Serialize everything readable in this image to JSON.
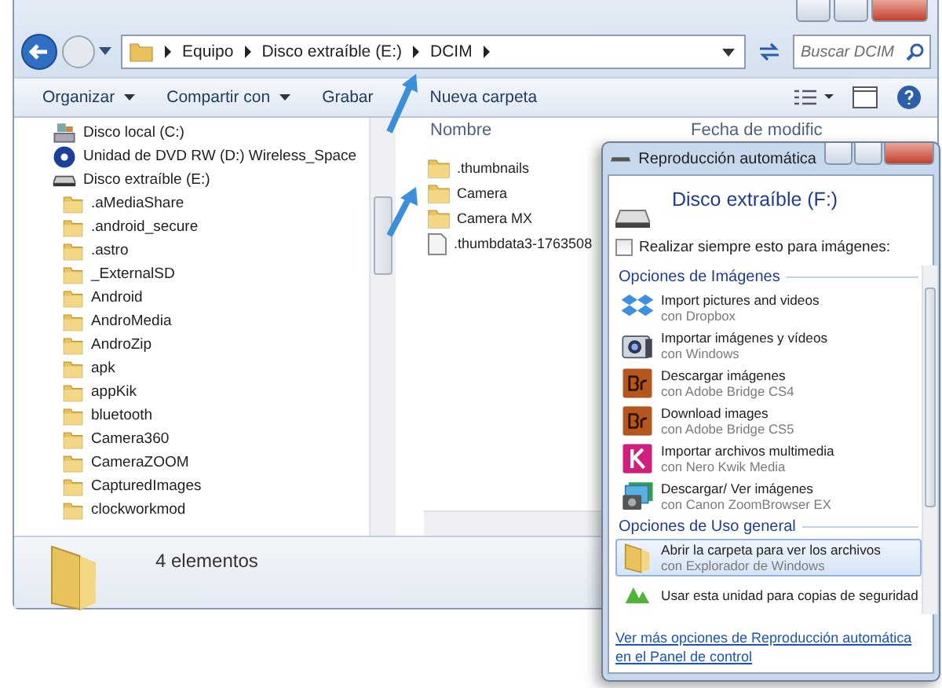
{
  "explorer": {
    "breadcrumb": [
      "Equipo",
      "Disco extraíble (E:)",
      "DCIM"
    ],
    "search": {
      "placeholder": "Buscar DCIM"
    },
    "toolbar": [
      {
        "label": "Organizar",
        "menu": true
      },
      {
        "label": "Compartir con",
        "menu": true
      },
      {
        "label": "Grabar",
        "menu": false
      },
      {
        "label": "Nueva carpeta",
        "menu": false
      }
    ],
    "sidebar": {
      "items": [
        {
          "label": "Disco local (C:)",
          "kind": "disk"
        },
        {
          "label": "Unidad de DVD RW (D:) Wireless_Space",
          "kind": "dvd"
        },
        {
          "label": "Disco extraíble (E:)",
          "kind": "removable",
          "children": [
            {
              "label": ".aMediaShare",
              "kind": "folder"
            },
            {
              "label": ".android_secure",
              "kind": "folder"
            },
            {
              "label": ".astro",
              "kind": "folder"
            },
            {
              "label": "_ExternalSD",
              "kind": "folder"
            },
            {
              "label": "Android",
              "kind": "folder"
            },
            {
              "label": "AndroMedia",
              "kind": "folder"
            },
            {
              "label": "AndroZip",
              "kind": "folder"
            },
            {
              "label": "apk",
              "kind": "folder"
            },
            {
              "label": "appKik",
              "kind": "folder"
            },
            {
              "label": "bluetooth",
              "kind": "folder"
            },
            {
              "label": "Camera360",
              "kind": "folder"
            },
            {
              "label": "CameraZOOM",
              "kind": "folder"
            },
            {
              "label": "CapturedImages",
              "kind": "folder"
            },
            {
              "label": "clockworkmod",
              "kind": "folder"
            }
          ]
        }
      ]
    },
    "columns": [
      "Nombre",
      "Fecha de modific"
    ],
    "files": [
      {
        "name": ".thumbnails",
        "kind": "folder"
      },
      {
        "name": "Camera",
        "kind": "folder"
      },
      {
        "name": "Camera MX",
        "kind": "folder"
      },
      {
        "name": ".thumbdata3-1763508",
        "kind": "file"
      }
    ],
    "status_bar": "4 elementos"
  },
  "autoplay": {
    "title": "Reproducción automática",
    "device": "Disco extraíble (F:)",
    "always": {
      "label": "Realizar siempre esto para imágenes:",
      "checked": false
    },
    "groups": [
      {
        "title": "Opciones de Imágenes",
        "items": [
          {
            "action": "Import pictures and videos",
            "app": "con Dropbox",
            "kind": "dropbox",
            "selected": false
          },
          {
            "action": "Importar imágenes y vídeos",
            "app": "con Windows",
            "kind": "camera",
            "selected": false
          },
          {
            "action": "Descargar imágenes",
            "app": "con Adobe Bridge CS4",
            "kind": "bridge",
            "selected": false
          },
          {
            "action": "Download images",
            "app": "con Adobe Bridge CS5",
            "kind": "bridge",
            "selected": false
          },
          {
            "action": "Importar archivos multimedia",
            "app": "con Nero Kwik Media",
            "kind": "kwik",
            "selected": false
          },
          {
            "action": "Descargar/ Ver imágenes",
            "app": "con Canon ZoomBrowser EX",
            "kind": "photos",
            "selected": false
          }
        ]
      },
      {
        "title": "Opciones de Uso general",
        "items": [
          {
            "action": "Abrir la carpeta para ver los archivos",
            "app": "con Explorador de Windows",
            "kind": "folder",
            "selected": true
          },
          {
            "action": "Usar esta unidad para copias de seguridad",
            "kind": "backup",
            "selected": false
          }
        ]
      }
    ],
    "link": "Ver más opciones de Reproducción automática en el Panel de control"
  }
}
